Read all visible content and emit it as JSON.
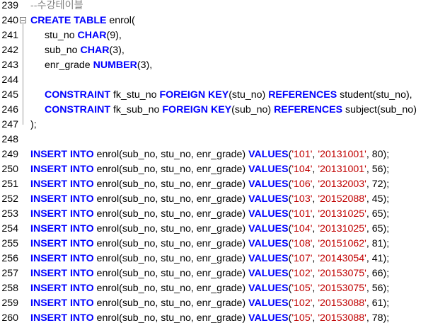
{
  "editor": {
    "lines": [
      {
        "n": "239",
        "tokens": [
          {
            "t": "cmt",
            "v": "--수강테이블"
          }
        ]
      },
      {
        "n": "240",
        "fold": true,
        "tokens": [
          {
            "t": "kw",
            "v": "CREATE TABLE"
          },
          {
            "t": "tx",
            "v": " enrol("
          }
        ]
      },
      {
        "n": "241",
        "indent": true,
        "tokens": [
          {
            "t": "tx",
            "v": "stu_no "
          },
          {
            "t": "kw",
            "v": "CHAR"
          },
          {
            "t": "tx",
            "v": "(9),"
          }
        ]
      },
      {
        "n": "242",
        "indent": true,
        "tokens": [
          {
            "t": "tx",
            "v": "sub_no "
          },
          {
            "t": "kw",
            "v": "CHAR"
          },
          {
            "t": "tx",
            "v": "(3),"
          }
        ]
      },
      {
        "n": "243",
        "indent": true,
        "tokens": [
          {
            "t": "tx",
            "v": "enr_grade "
          },
          {
            "t": "kw",
            "v": "NUMBER"
          },
          {
            "t": "tx",
            "v": "(3),"
          }
        ]
      },
      {
        "n": "244",
        "tokens": []
      },
      {
        "n": "245",
        "indent": true,
        "tokens": [
          {
            "t": "kw",
            "v": "CONSTRAINT"
          },
          {
            "t": "tx",
            "v": " fk_stu_no "
          },
          {
            "t": "kw",
            "v": "FOREIGN KEY"
          },
          {
            "t": "tx",
            "v": "(stu_no) "
          },
          {
            "t": "kw",
            "v": "REFERENCES"
          },
          {
            "t": "tx",
            "v": " student(stu_no),"
          }
        ]
      },
      {
        "n": "246",
        "indent": true,
        "tokens": [
          {
            "t": "kw",
            "v": "CONSTRAINT"
          },
          {
            "t": "tx",
            "v": " fk_sub_no "
          },
          {
            "t": "kw",
            "v": "FOREIGN KEY"
          },
          {
            "t": "tx",
            "v": "(sub_no) "
          },
          {
            "t": "kw",
            "v": "REFERENCES"
          },
          {
            "t": "tx",
            "v": " subject(sub_no)"
          }
        ]
      },
      {
        "n": "247",
        "tokens": [
          {
            "t": "tx",
            "v": ");"
          }
        ]
      },
      {
        "n": "248",
        "tokens": []
      },
      {
        "n": "249",
        "tokens": [
          {
            "t": "kw",
            "v": "INSERT INTO"
          },
          {
            "t": "tx",
            "v": " enrol(sub_no, stu_no, enr_grade) "
          },
          {
            "t": "kw",
            "v": "VALUES"
          },
          {
            "t": "tx",
            "v": "("
          },
          {
            "t": "str",
            "v": "'101'"
          },
          {
            "t": "tx",
            "v": ", "
          },
          {
            "t": "str",
            "v": "'20131001'"
          },
          {
            "t": "tx",
            "v": ", 80);"
          }
        ]
      },
      {
        "n": "250",
        "tokens": [
          {
            "t": "kw",
            "v": "INSERT INTO"
          },
          {
            "t": "tx",
            "v": " enrol(sub_no, stu_no, enr_grade) "
          },
          {
            "t": "kw",
            "v": "VALUES"
          },
          {
            "t": "tx",
            "v": "("
          },
          {
            "t": "str",
            "v": "'104'"
          },
          {
            "t": "tx",
            "v": ", "
          },
          {
            "t": "str",
            "v": "'20131001'"
          },
          {
            "t": "tx",
            "v": ", 56);"
          }
        ]
      },
      {
        "n": "251",
        "tokens": [
          {
            "t": "kw",
            "v": "INSERT INTO"
          },
          {
            "t": "tx",
            "v": " enrol(sub_no, stu_no, enr_grade) "
          },
          {
            "t": "kw",
            "v": "VALUES"
          },
          {
            "t": "tx",
            "v": "("
          },
          {
            "t": "str",
            "v": "'106'"
          },
          {
            "t": "tx",
            "v": ", "
          },
          {
            "t": "str",
            "v": "'20132003'"
          },
          {
            "t": "tx",
            "v": ", 72);"
          }
        ]
      },
      {
        "n": "252",
        "tokens": [
          {
            "t": "kw",
            "v": "INSERT INTO"
          },
          {
            "t": "tx",
            "v": " enrol(sub_no, stu_no, enr_grade) "
          },
          {
            "t": "kw",
            "v": "VALUES"
          },
          {
            "t": "tx",
            "v": "("
          },
          {
            "t": "str",
            "v": "'103'"
          },
          {
            "t": "tx",
            "v": ", "
          },
          {
            "t": "str",
            "v": "'20152088'"
          },
          {
            "t": "tx",
            "v": ", 45);"
          }
        ]
      },
      {
        "n": "253",
        "tokens": [
          {
            "t": "kw",
            "v": "INSERT INTO"
          },
          {
            "t": "tx",
            "v": " enrol(sub_no, stu_no, enr_grade) "
          },
          {
            "t": "kw",
            "v": "VALUES"
          },
          {
            "t": "tx",
            "v": "("
          },
          {
            "t": "str",
            "v": "'101'"
          },
          {
            "t": "tx",
            "v": ", "
          },
          {
            "t": "str",
            "v": "'20131025'"
          },
          {
            "t": "tx",
            "v": ", 65);"
          }
        ]
      },
      {
        "n": "254",
        "tokens": [
          {
            "t": "kw",
            "v": "INSERT INTO"
          },
          {
            "t": "tx",
            "v": " enrol(sub_no, stu_no, enr_grade) "
          },
          {
            "t": "kw",
            "v": "VALUES"
          },
          {
            "t": "tx",
            "v": "("
          },
          {
            "t": "str",
            "v": "'104'"
          },
          {
            "t": "tx",
            "v": ", "
          },
          {
            "t": "str",
            "v": "'20131025'"
          },
          {
            "t": "tx",
            "v": ", 65);"
          }
        ]
      },
      {
        "n": "255",
        "tokens": [
          {
            "t": "kw",
            "v": "INSERT INTO"
          },
          {
            "t": "tx",
            "v": " enrol(sub_no, stu_no, enr_grade) "
          },
          {
            "t": "kw",
            "v": "VALUES"
          },
          {
            "t": "tx",
            "v": "("
          },
          {
            "t": "str",
            "v": "'108'"
          },
          {
            "t": "tx",
            "v": ", "
          },
          {
            "t": "str",
            "v": "'20151062'"
          },
          {
            "t": "tx",
            "v": ", 81);"
          }
        ]
      },
      {
        "n": "256",
        "tokens": [
          {
            "t": "kw",
            "v": "INSERT INTO"
          },
          {
            "t": "tx",
            "v": " enrol(sub_no, stu_no, enr_grade) "
          },
          {
            "t": "kw",
            "v": "VALUES"
          },
          {
            "t": "tx",
            "v": "("
          },
          {
            "t": "str",
            "v": "'107'"
          },
          {
            "t": "tx",
            "v": ", "
          },
          {
            "t": "str",
            "v": "'20143054'"
          },
          {
            "t": "tx",
            "v": ", 41);"
          }
        ]
      },
      {
        "n": "257",
        "tokens": [
          {
            "t": "kw",
            "v": "INSERT INTO"
          },
          {
            "t": "tx",
            "v": " enrol(sub_no, stu_no, enr_grade) "
          },
          {
            "t": "kw",
            "v": "VALUES"
          },
          {
            "t": "tx",
            "v": "("
          },
          {
            "t": "str",
            "v": "'102'"
          },
          {
            "t": "tx",
            "v": ", "
          },
          {
            "t": "str",
            "v": "'20153075'"
          },
          {
            "t": "tx",
            "v": ", 66);"
          }
        ]
      },
      {
        "n": "258",
        "tokens": [
          {
            "t": "kw",
            "v": "INSERT INTO"
          },
          {
            "t": "tx",
            "v": " enrol(sub_no, stu_no, enr_grade) "
          },
          {
            "t": "kw",
            "v": "VALUES"
          },
          {
            "t": "tx",
            "v": "("
          },
          {
            "t": "str",
            "v": "'105'"
          },
          {
            "t": "tx",
            "v": ", "
          },
          {
            "t": "str",
            "v": "'20153075'"
          },
          {
            "t": "tx",
            "v": ", 56);"
          }
        ]
      },
      {
        "n": "259",
        "tokens": [
          {
            "t": "kw",
            "v": "INSERT INTO"
          },
          {
            "t": "tx",
            "v": " enrol(sub_no, stu_no, enr_grade) "
          },
          {
            "t": "kw",
            "v": "VALUES"
          },
          {
            "t": "tx",
            "v": "("
          },
          {
            "t": "str",
            "v": "'102'"
          },
          {
            "t": "tx",
            "v": ", "
          },
          {
            "t": "str",
            "v": "'20153088'"
          },
          {
            "t": "tx",
            "v": ", 61);"
          }
        ]
      },
      {
        "n": "260",
        "tokens": [
          {
            "t": "kw",
            "v": "INSERT INTO"
          },
          {
            "t": "tx",
            "v": " enrol(sub_no, stu_no, enr_grade) "
          },
          {
            "t": "kw",
            "v": "VALUES"
          },
          {
            "t": "tx",
            "v": "("
          },
          {
            "t": "str",
            "v": "'105'"
          },
          {
            "t": "tx",
            "v": ", "
          },
          {
            "t": "str",
            "v": "'20153088'"
          },
          {
            "t": "tx",
            "v": ", 78);"
          }
        ]
      }
    ]
  },
  "colors": {
    "keyword": "#0000ff",
    "comment": "#808080",
    "string": "#c00000",
    "text": "#000000",
    "background": "#ffffff"
  }
}
